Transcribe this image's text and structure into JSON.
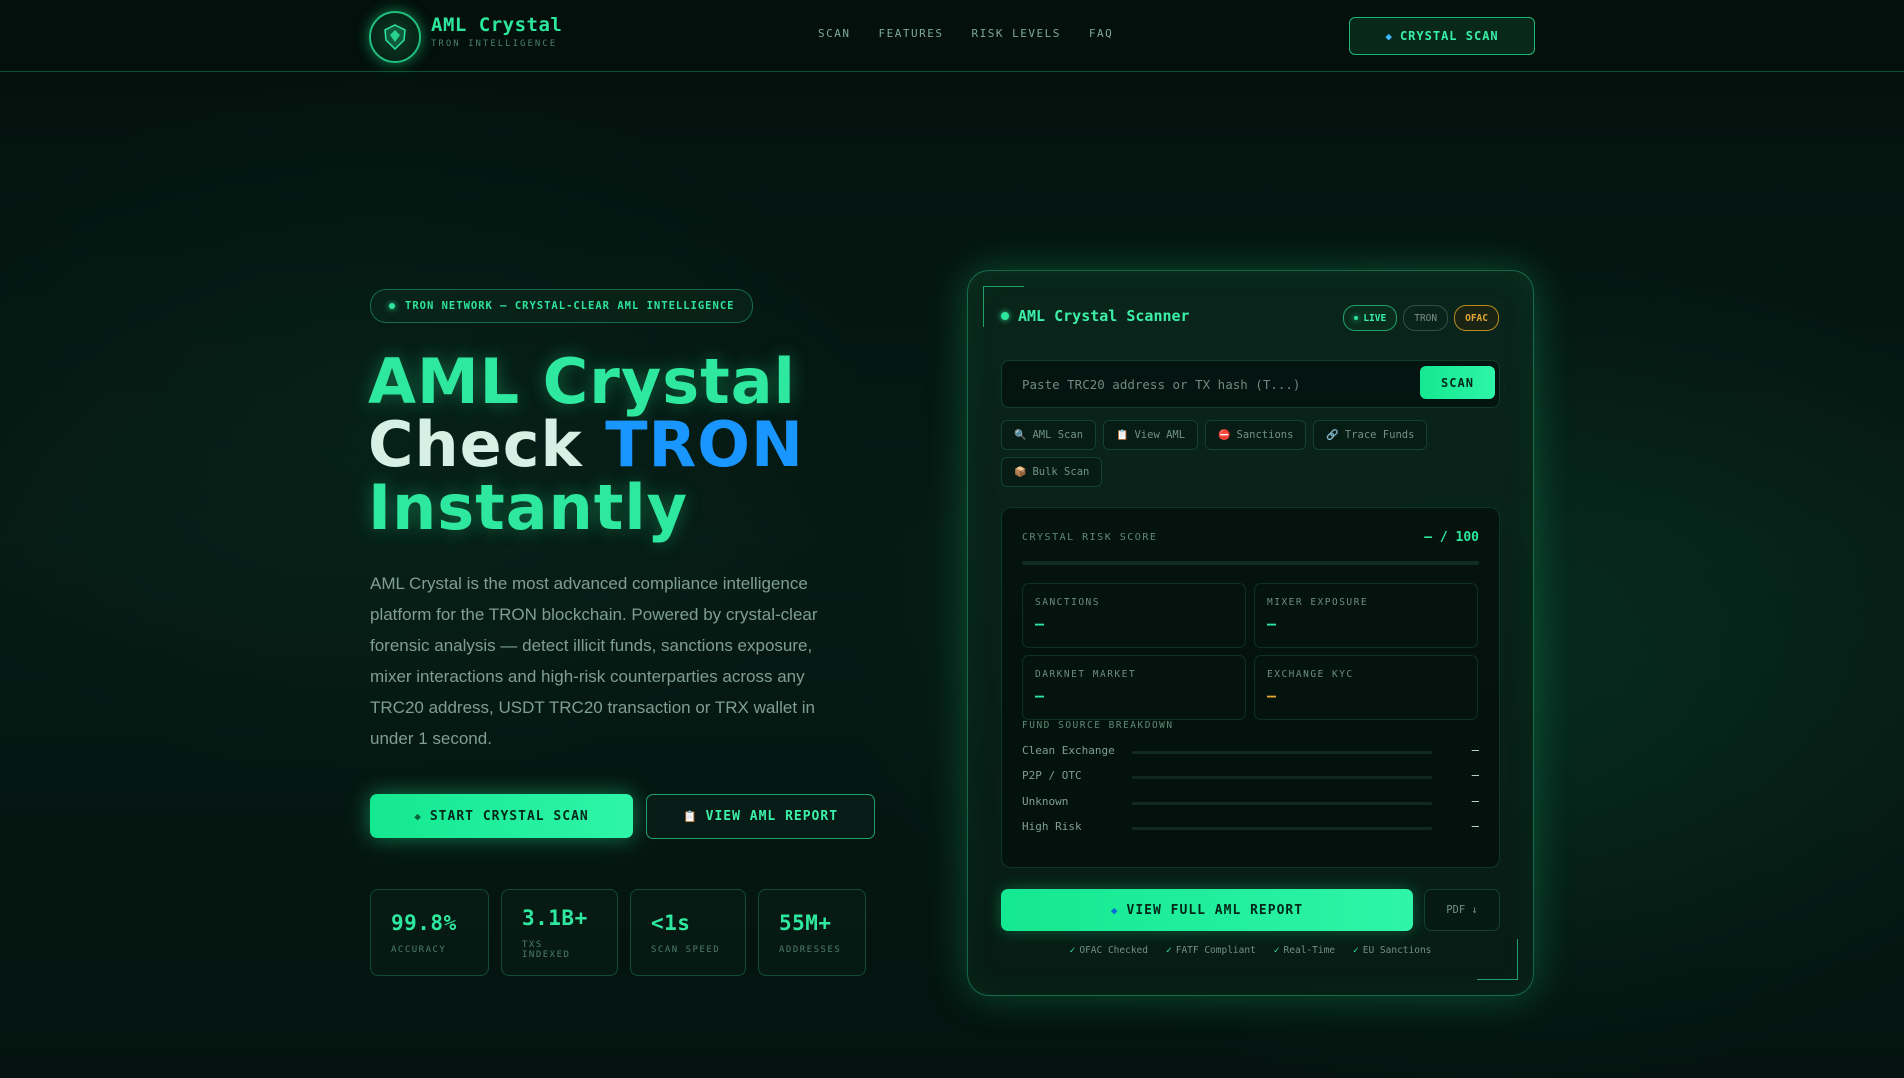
{
  "header": {
    "brand_title": "AML Crystal",
    "brand_sub": "TRON INTELLIGENCE",
    "logo_icon": "crystal-shield-icon",
    "nav": [
      "SCAN",
      "FEATURES",
      "RISK LEVELS",
      "FAQ"
    ],
    "cta_label": "CRYSTAL SCAN",
    "cta_icon": "gem-icon"
  },
  "hero": {
    "tag": "TRON NETWORK — CRYSTAL-CLEAR AML INTELLIGENCE",
    "title_line1": "AML Crystal",
    "title_line2a": "Check ",
    "title_line2b": "TRON",
    "title_line3": "Instantly",
    "description": "AML Crystal is the most advanced compliance intelligence platform for the TRON blockchain. Powered by crystal-clear forensic analysis — detect illicit funds, sanctions exposure, mixer interactions and high-risk counterparties across any TRC20 address, USDT TRC20 transaction or TRX wallet in under 1 second.",
    "primary_btn": "START CRYSTAL SCAN",
    "secondary_btn": "VIEW AML REPORT",
    "stats": [
      {
        "value": "99.8%",
        "label": "ACCURACY"
      },
      {
        "value": "3.1B+",
        "label": "TXS INDEXED"
      },
      {
        "value": "<1s",
        "label": "SCAN SPEED"
      },
      {
        "value": "55M+",
        "label": "ADDRESSES"
      }
    ]
  },
  "scanner": {
    "title": "AML Crystal Scanner",
    "badges": {
      "live": "LIVE",
      "tron": "TRON",
      "ofac": "OFAC"
    },
    "search_placeholder": "Paste TRC20 address or TX hash (T...)",
    "scan_btn": "SCAN",
    "chips": [
      {
        "icon": "magnifier-icon",
        "glyph": "🔍",
        "label": "AML Scan"
      },
      {
        "icon": "clipboard-icon",
        "glyph": "📋",
        "label": "View AML"
      },
      {
        "icon": "no-entry-icon",
        "glyph": "⛔",
        "label": "Sanctions"
      },
      {
        "icon": "link-icon",
        "glyph": "🔗",
        "label": "Trace Funds"
      },
      {
        "icon": "box-icon",
        "glyph": "📦",
        "label": "Bulk Scan"
      }
    ],
    "risk_label": "CRYSTAL RISK SCORE",
    "risk_score": "— / 100",
    "metrics": [
      {
        "label": "SANCTIONS",
        "value": "—"
      },
      {
        "label": "MIXER EXPOSURE",
        "value": "—"
      },
      {
        "label": "DARKNET MARKET",
        "value": "—"
      },
      {
        "label": "EXCHANGE KYC",
        "value": "—"
      }
    ],
    "fund_title": "FUND SOURCE BREAKDOWN",
    "funds": [
      {
        "label": "Clean Exchange",
        "value": "—"
      },
      {
        "label": "P2P / OTC",
        "value": "—"
      },
      {
        "label": "Unknown",
        "value": "—"
      },
      {
        "label": "High Risk",
        "value": "—"
      }
    ],
    "report_btn": "VIEW FULL AML REPORT",
    "pdf_btn": "PDF ↓",
    "compliance": [
      "OFAC Checked",
      "FATF Compliant",
      "Real-Time",
      "EU Sanctions"
    ],
    "check_glyph": "✓"
  },
  "colors": {
    "accent": "#2ee59c",
    "tron_blue": "#1996ff",
    "warn": "#e3a733",
    "bg": "#041410"
  }
}
